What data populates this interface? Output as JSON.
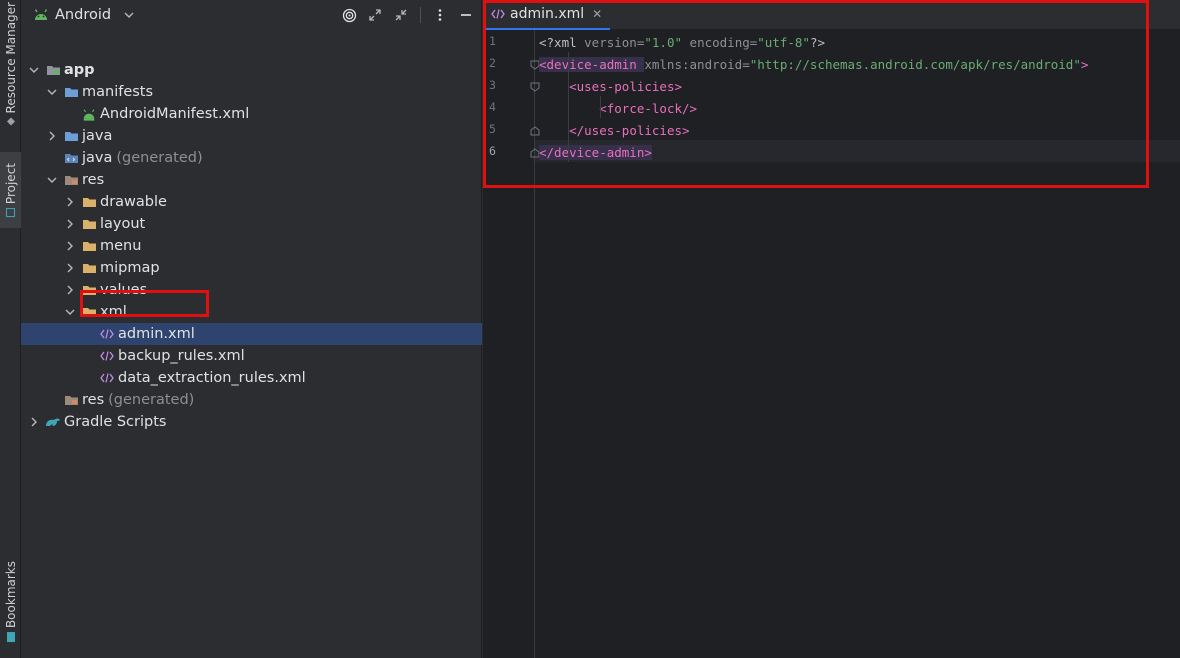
{
  "strip": {
    "resource_manager": "Resource Manager",
    "project": "Project",
    "bookmarks": "Bookmarks"
  },
  "project_panel": {
    "view": "Android",
    "tree": [
      {
        "label": "app",
        "extra": "",
        "indent": 0,
        "chev": "down",
        "icon": "folder-app-icon",
        "bold": true
      },
      {
        "label": "manifests",
        "extra": "",
        "indent": 1,
        "chev": "down",
        "icon": "folder-icon",
        "bold": false
      },
      {
        "label": "AndroidManifest.xml",
        "extra": "",
        "indent": 2,
        "chev": "",
        "icon": "android-icon",
        "bold": false
      },
      {
        "label": "java",
        "extra": "",
        "indent": 1,
        "chev": "right",
        "icon": "folder-icon",
        "bold": false
      },
      {
        "label": "java",
        "extra": "(generated)",
        "indent": 1,
        "chev": "",
        "icon": "folder-generated-icon",
        "bold": false
      },
      {
        "label": "res",
        "extra": "",
        "indent": 1,
        "chev": "down",
        "icon": "folder-res-icon",
        "bold": false
      },
      {
        "label": "drawable",
        "extra": "",
        "indent": 2,
        "chev": "right",
        "icon": "folder-yellow-icon",
        "bold": false
      },
      {
        "label": "layout",
        "extra": "",
        "indent": 2,
        "chev": "right",
        "icon": "folder-yellow-icon",
        "bold": false
      },
      {
        "label": "menu",
        "extra": "",
        "indent": 2,
        "chev": "right",
        "icon": "folder-yellow-icon",
        "bold": false
      },
      {
        "label": "mipmap",
        "extra": "",
        "indent": 2,
        "chev": "right",
        "icon": "folder-yellow-icon",
        "bold": false
      },
      {
        "label": "values",
        "extra": "",
        "indent": 2,
        "chev": "right",
        "icon": "folder-yellow-icon",
        "bold": false
      },
      {
        "label": "xml",
        "extra": "",
        "indent": 2,
        "chev": "down",
        "icon": "folder-yellow-icon",
        "bold": false
      },
      {
        "label": "admin.xml",
        "extra": "",
        "indent": 3,
        "chev": "",
        "icon": "xml-file-icon",
        "bold": false,
        "selected": true
      },
      {
        "label": "backup_rules.xml",
        "extra": "",
        "indent": 3,
        "chev": "",
        "icon": "xml-file-icon",
        "bold": false
      },
      {
        "label": "data_extraction_rules.xml",
        "extra": "",
        "indent": 3,
        "chev": "",
        "icon": "xml-file-icon",
        "bold": false
      },
      {
        "label": "res",
        "extra": "(generated)",
        "indent": 1,
        "chev": "",
        "icon": "folder-res-icon",
        "bold": false
      },
      {
        "label": "Gradle Scripts",
        "extra": "",
        "indent": 0,
        "chev": "right",
        "icon": "gradle-icon",
        "bold": false
      }
    ]
  },
  "editor": {
    "tab_label": "admin.xml",
    "lines": [
      {
        "n": "1",
        "parts": [
          [
            "t-plain",
            "<?xml "
          ],
          [
            "t-attr",
            "version="
          ],
          [
            "t-str",
            "\"1.0\""
          ],
          [
            "t-plain",
            " "
          ],
          [
            "t-attr",
            "encoding="
          ],
          [
            "t-str",
            "\"utf-8\""
          ],
          [
            "t-plain",
            "?>"
          ]
        ]
      },
      {
        "n": "2",
        "parts": [
          [
            "t-pink",
            "<device-admin "
          ],
          [
            "t-attr",
            "xmlns:android="
          ],
          [
            "t-str",
            "\"http://schemas.android.com/apk/res/android\""
          ],
          [
            "t-pink",
            ">"
          ]
        ]
      },
      {
        "n": "3",
        "parts": [
          [
            "t-plain",
            "    "
          ],
          [
            "t-pink",
            "<uses-policies>"
          ]
        ]
      },
      {
        "n": "4",
        "parts": [
          [
            "t-plain",
            "        "
          ],
          [
            "t-pink",
            "<force-lock/>"
          ]
        ]
      },
      {
        "n": "5",
        "parts": [
          [
            "t-plain",
            "    "
          ],
          [
            "t-pink",
            "</uses-policies>"
          ]
        ]
      },
      {
        "n": "6",
        "parts": [
          [
            "t-pink",
            "</device-admin>"
          ]
        ]
      }
    ]
  },
  "colors": {
    "selection": "#2e436e",
    "highlight_box": "#e01010",
    "tag": "#e86fbc",
    "string": "#6aab73"
  }
}
